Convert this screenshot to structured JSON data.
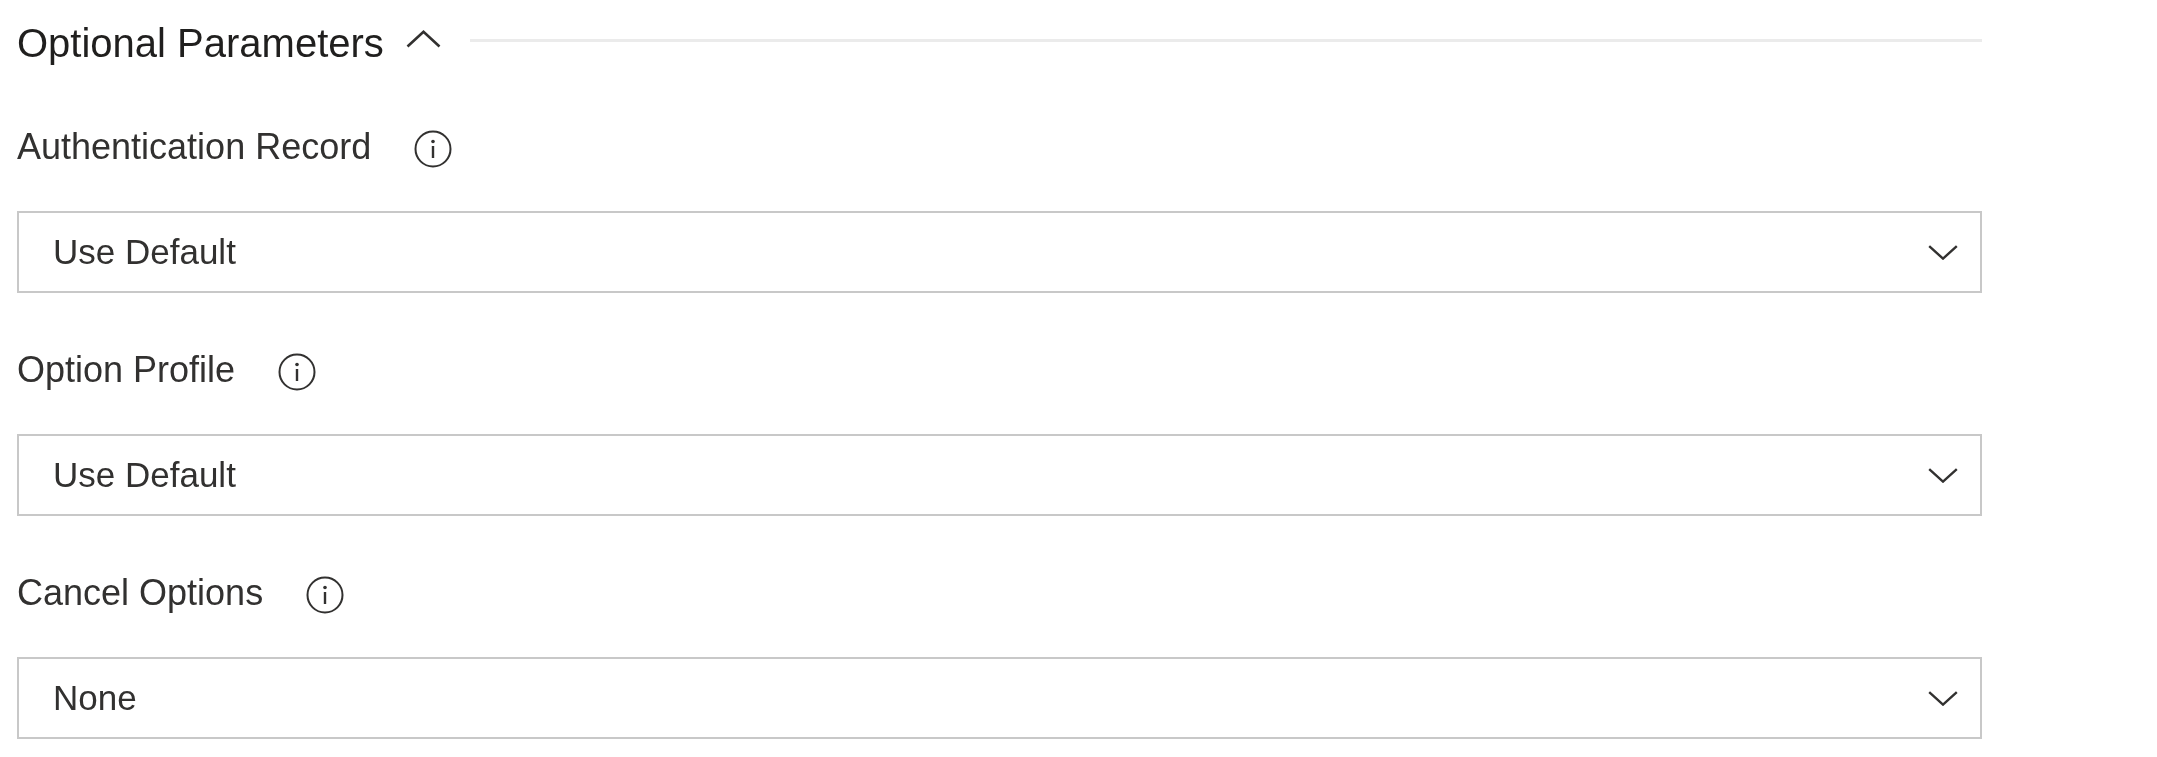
{
  "section": {
    "title": "Optional Parameters",
    "expanded": true
  },
  "fields": [
    {
      "label": "Authentication Record",
      "value": "Use Default"
    },
    {
      "label": "Option Profile",
      "value": "Use Default"
    },
    {
      "label": "Cancel Options",
      "value": "None"
    }
  ]
}
